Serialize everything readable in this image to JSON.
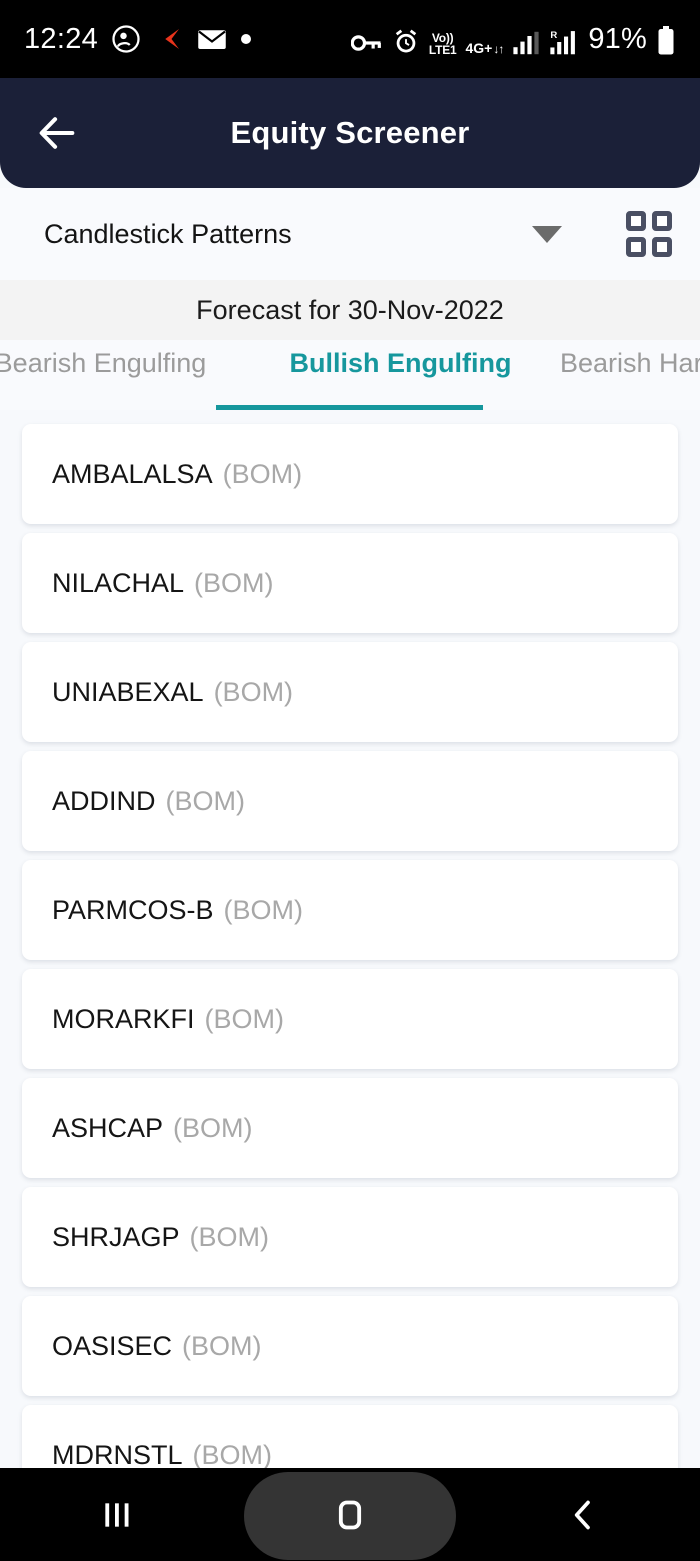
{
  "status_bar": {
    "time": "12:24",
    "battery_percent": "91%",
    "icons": [
      "profile-circle-icon",
      "red-chevron-icon",
      "envelope-icon",
      "dot-icon",
      "vpn-key-icon",
      "alarm-icon",
      "volte-icon",
      "signal-icon",
      "roaming-signal-icon",
      "battery-icon"
    ],
    "volte_label": "Vo))",
    "lte_label": "LTE1",
    "network_label": "4G+",
    "roaming_label": "R"
  },
  "header": {
    "title": "Equity Screener",
    "back_icon": "arrow-left-icon",
    "background_color": "#1b2038"
  },
  "filter": {
    "selected": "Candlestick Patterns",
    "caret_icon": "chevron-down-icon",
    "grid_icon": "grid-view-icon"
  },
  "forecast": {
    "text": "Forecast for 30-Nov-2022"
  },
  "tabs": {
    "active_color": "#16979d",
    "items": [
      {
        "label": "Bearish Engulfing",
        "active": false
      },
      {
        "label": "Bullish Engulfing",
        "active": true
      },
      {
        "label": "Bearish Harami",
        "active": false
      }
    ]
  },
  "stock_list": {
    "exchange": "(BOM)",
    "items": [
      {
        "ticker": "AMBALALSA",
        "exchange": "(BOM)"
      },
      {
        "ticker": "NILACHAL",
        "exchange": "(BOM)"
      },
      {
        "ticker": "UNIABEXAL",
        "exchange": "(BOM)"
      },
      {
        "ticker": "ADDIND",
        "exchange": "(BOM)"
      },
      {
        "ticker": "PARMCOS-B",
        "exchange": "(BOM)"
      },
      {
        "ticker": "MORARKFI",
        "exchange": "(BOM)"
      },
      {
        "ticker": "ASHCAP",
        "exchange": "(BOM)"
      },
      {
        "ticker": "SHRJAGP",
        "exchange": "(BOM)"
      },
      {
        "ticker": "OASISEC",
        "exchange": "(BOM)"
      },
      {
        "ticker": "MDRNSTL",
        "exchange": "(BOM)"
      }
    ]
  },
  "nav_bar": {
    "recents_icon": "recents-icon",
    "home_icon": "home-icon",
    "back_icon": "back-chevron-icon"
  }
}
